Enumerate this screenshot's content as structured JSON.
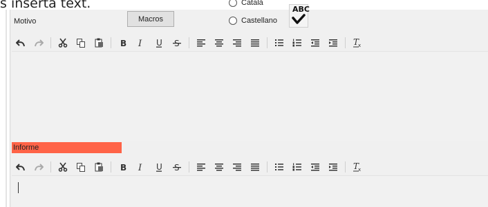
{
  "page": {
    "top_text": "s insertà text."
  },
  "motivo": {
    "label": "Motivo"
  },
  "macros_button": {
    "label": "Macros"
  },
  "language": {
    "options": [
      {
        "label": "Català",
        "selected": false
      },
      {
        "label": "Castellano",
        "selected": false
      }
    ]
  },
  "spellcheck": {
    "label": "ABC",
    "icon": "spellcheck-icon"
  },
  "informe": {
    "label": "Informe",
    "color": "#ff6347"
  },
  "toolbar_icons": [
    "undo-icon",
    "redo-icon",
    "cut-icon",
    "copy-icon",
    "paste-icon",
    "bold-icon",
    "italic-icon",
    "underline-icon",
    "strikethrough-icon",
    "align-left-icon",
    "align-center-icon",
    "align-right-icon",
    "align-justify-icon",
    "bulleted-list-icon",
    "numbered-list-icon",
    "outdent-icon",
    "indent-icon",
    "clear-formatting-icon"
  ]
}
